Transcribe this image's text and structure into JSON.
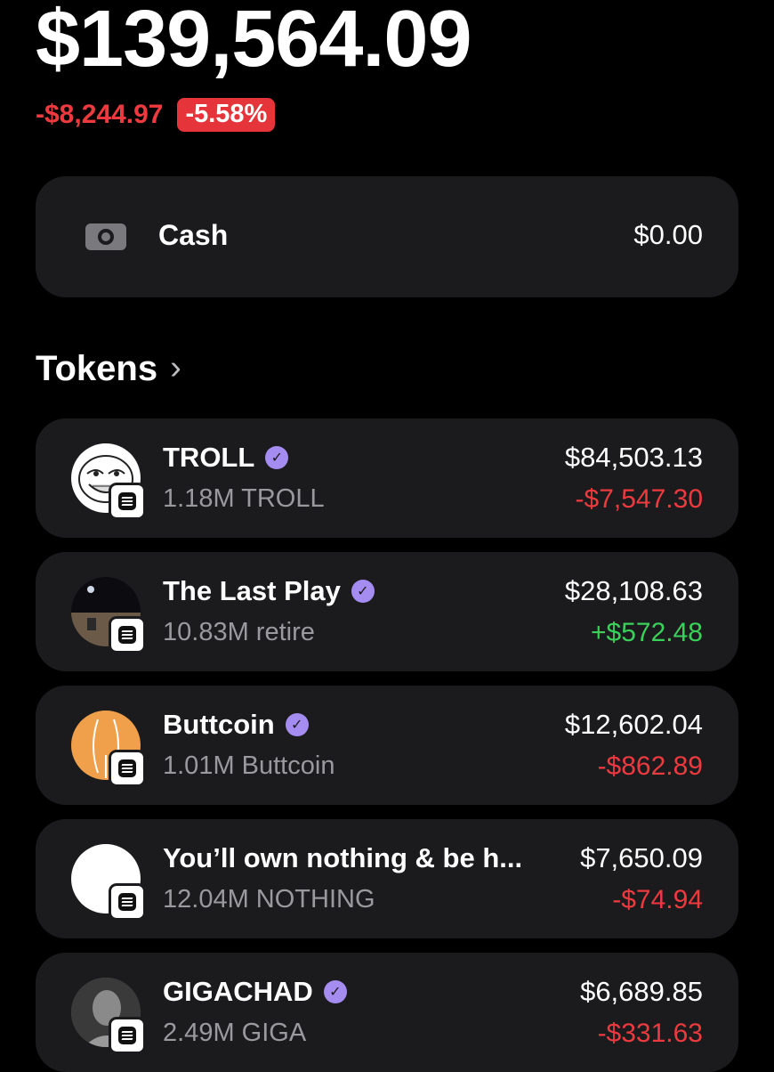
{
  "portfolio": {
    "balance": "$139,564.09",
    "change_amount": "-$8,244.97",
    "change_percent": "-5.58%"
  },
  "cash": {
    "icon": "cash-icon",
    "label": "Cash",
    "value": "$0.00"
  },
  "tokens_section": {
    "title": "Tokens",
    "chevron": "›"
  },
  "tokens": [
    {
      "name": "TROLL",
      "amount": "1.18M TROLL",
      "value": "$84,503.13",
      "change": "-$7,547.30",
      "direction": "down"
    },
    {
      "name": "The Last Play",
      "amount": "10.83M retire",
      "value": "$28,108.63",
      "change": "+$572.48",
      "direction": "up"
    },
    {
      "name": "Buttcoin",
      "amount": "1.01M Buttcoin",
      "value": "$12,602.04",
      "change": "-$862.89",
      "direction": "down"
    },
    {
      "name": "You’ll own nothing & be h...",
      "amount": "12.04M NOTHING",
      "value": "$7,650.09",
      "change": "-$74.94",
      "direction": "down"
    },
    {
      "name": "GIGACHAD",
      "amount": "2.49M GIGA",
      "value": "$6,689.85",
      "change": "-$331.63",
      "direction": "down"
    }
  ],
  "colors": {
    "negative": "#ec3a3f",
    "positive": "#39d159",
    "verified": "#a58cf0",
    "card": "#1b1b1d"
  }
}
